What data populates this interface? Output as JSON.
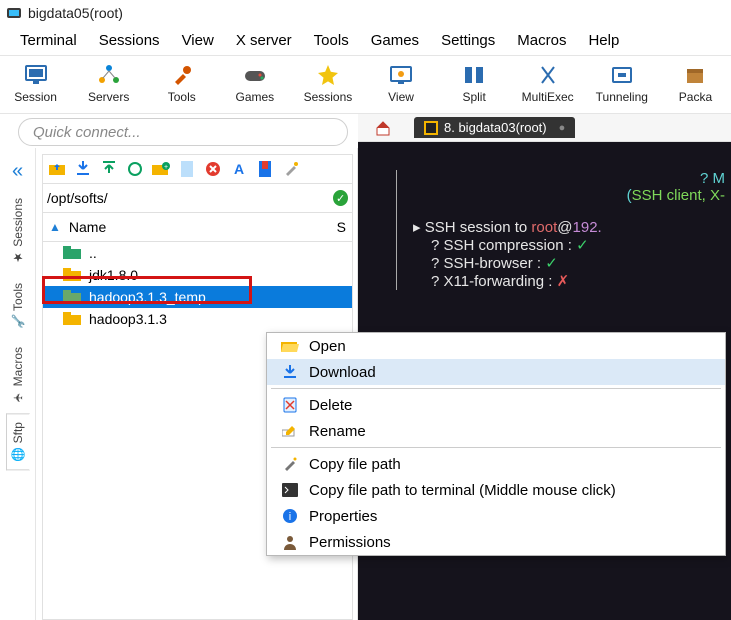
{
  "window": {
    "title": "bigdata05(root)"
  },
  "menubar": [
    "Terminal",
    "Sessions",
    "View",
    "X server",
    "Tools",
    "Games",
    "Settings",
    "Macros",
    "Help"
  ],
  "toolbar": [
    {
      "icon": "monitor",
      "label": "Session"
    },
    {
      "icon": "nodes",
      "label": "Servers"
    },
    {
      "icon": "wrench",
      "label": "Tools"
    },
    {
      "icon": "gamepad",
      "label": "Games"
    },
    {
      "icon": "star",
      "label": "Sessions"
    },
    {
      "icon": "eye",
      "label": "View"
    },
    {
      "icon": "split",
      "label": "Split"
    },
    {
      "icon": "multi",
      "label": "MultiExec"
    },
    {
      "icon": "tunnel",
      "label": "Tunneling"
    },
    {
      "icon": "package",
      "label": "Packa"
    }
  ],
  "quick_connect_placeholder": "Quick connect...",
  "left_rail": {
    "tabs": [
      {
        "label": "Sessions",
        "icon": "star",
        "active": false
      },
      {
        "label": "Tools",
        "icon": "wrench",
        "active": false
      },
      {
        "label": "Macros",
        "icon": "plane",
        "active": false
      },
      {
        "label": "Sftp",
        "icon": "globe",
        "active": true
      }
    ]
  },
  "file_panel": {
    "path": "/opt/softs/",
    "header": "Name",
    "second_col": "S",
    "rows": [
      {
        "name": "..",
        "kind": "up",
        "sel": false
      },
      {
        "name": "jdk1.8.0",
        "kind": "folder",
        "sel": false
      },
      {
        "name": "hadoop3.1.3_temp",
        "kind": "folder",
        "sel": true
      },
      {
        "name": "hadoop3.1.3",
        "kind": "folder",
        "sel": false
      }
    ]
  },
  "tabs_right": {
    "home_icon": "home",
    "tabs": [
      {
        "icon": "term",
        "label": "8. bigdata03(root)"
      }
    ]
  },
  "terminal_lines": {
    "l0": "?  M",
    "l1_a": "(",
    "l1_b": "SSH client, X-",
    "l2_a": "▸ SSH session to ",
    "l2_b": "root",
    "l2_c": "@",
    "l2_d": "192.",
    "l3": "? SSH compression : ",
    "l4": "? SSH-browser     : ",
    "l5": "? X11-forwarding  : "
  },
  "context_menu": {
    "items": [
      {
        "icon": "folder-open",
        "label": "Open"
      },
      {
        "icon": "download",
        "label": "Download",
        "hover": true,
        "red": true
      },
      {
        "sep": true
      },
      {
        "icon": "delete",
        "label": "Delete"
      },
      {
        "icon": "rename",
        "label": "Rename"
      },
      {
        "sep": true
      },
      {
        "icon": "wand",
        "label": "Copy file path"
      },
      {
        "icon": "terminal",
        "label": "Copy file path to terminal (Middle mouse click)"
      },
      {
        "icon": "info",
        "label": "Properties"
      },
      {
        "icon": "person",
        "label": "Permissions"
      }
    ]
  }
}
